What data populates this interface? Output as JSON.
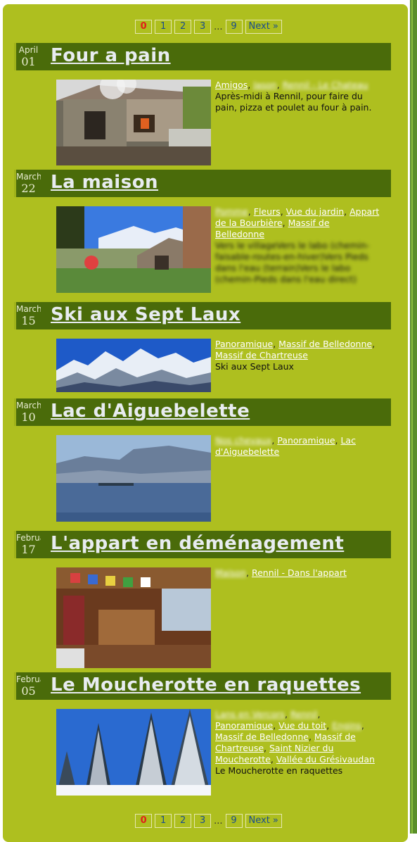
{
  "pager": {
    "pages": [
      "0",
      "1",
      "2",
      "3"
    ],
    "ellipsis": "...",
    "last": "9",
    "next": "Next »"
  },
  "posts": [
    {
      "month": "April",
      "day": "01",
      "title": "Four a pain",
      "tags": [
        "Amigos",
        "Jason",
        "Rennil - Le Chateau"
      ],
      "description": "Après-midi à Rennil, pour faire du pain, pizza et poulet au four à pain."
    },
    {
      "month": "March",
      "day": "22",
      "title": "La maison",
      "tags": [
        "Pomme",
        "Fleurs",
        "Vue du jardin",
        "Appart de la Bourbière",
        "Massif de Belledonne"
      ],
      "description": "Vers le villageVers le labo (chemin-faisable-routes-en-hiver)Vers Pieds dans l'eau (terrain)Vers le labo (chemin-Pieds dans l'eau direct)"
    },
    {
      "month": "March",
      "day": "15",
      "title": "Ski aux Sept Laux",
      "tags": [
        "Panoramique",
        "Massif de Belledonne",
        "Massif de Chartreuse"
      ],
      "description": "Ski aux Sept Laux"
    },
    {
      "month": "March",
      "day": "10",
      "title": "Lac d'Aiguebelette",
      "tags": [
        "Nos chevaux",
        "Panoramique",
        "Lac d'Aiguebelette"
      ],
      "description": ""
    },
    {
      "month": "February",
      "day": "17",
      "title": "L'appart en déménagement",
      "tags": [
        "Maison",
        "Rennil - Dans l'appart"
      ],
      "description": ""
    },
    {
      "month": "February",
      "day": "05",
      "title": "Le Moucherotte en raquettes",
      "tags": [
        "Lans en Vercors",
        "Rennil",
        "Panoramique",
        "Vue du toit",
        "Engins",
        "Massif de Belledonne",
        "Massif de Chartreuse",
        "Saint Nizier du Moucherotte",
        "Vallée du Grésivaudan"
      ],
      "description": "Le Moucherotte en raquettes"
    }
  ],
  "colors": {
    "panel": "#aebf1f",
    "header": "#4a6b0a",
    "sidebar": "#5a8f2a",
    "link": "#1a4d8f",
    "current_page": "#e0201a"
  }
}
